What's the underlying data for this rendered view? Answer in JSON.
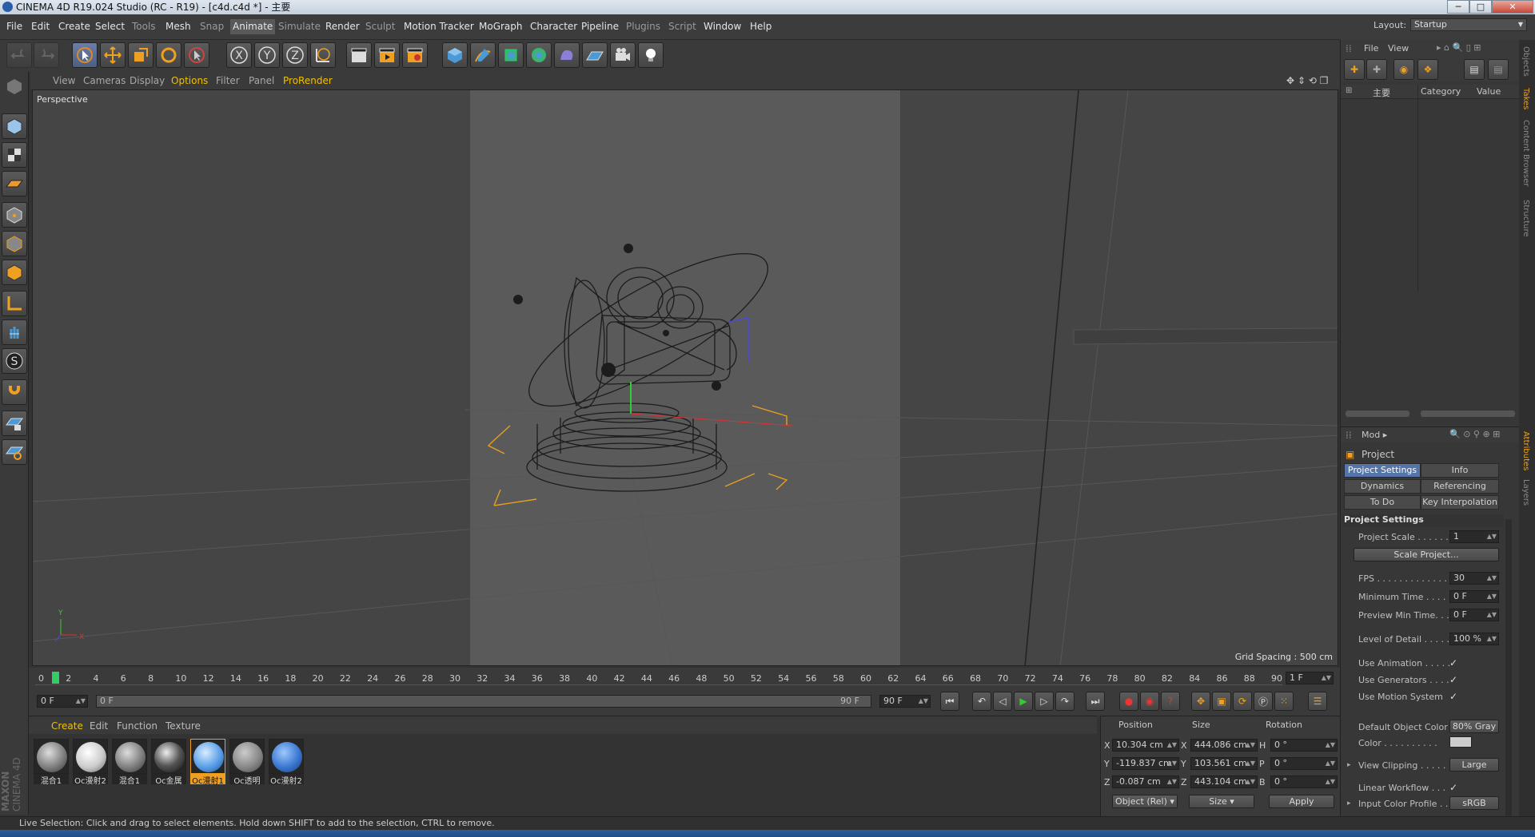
{
  "window": {
    "title": "CINEMA 4D R19.024 Studio (RC - R19) - [c4d.c4d *] - 主要",
    "min": "─",
    "max": "□",
    "close": "✕"
  },
  "menu": {
    "items": [
      "File",
      "Edit",
      "Create",
      "Select",
      "Tools",
      "Mesh",
      "Snap",
      "Animate",
      "Simulate",
      "Render",
      "Sculpt",
      "Motion Tracker",
      "MoGraph",
      "Character",
      "Pipeline",
      "Plugins",
      "Script",
      "Window",
      "Help"
    ],
    "layout_label": "Layout:",
    "layout_value": "Startup"
  },
  "viewport": {
    "menu": [
      "View",
      "Cameras",
      "Display",
      "Options",
      "Filter",
      "Panel",
      "ProRender"
    ],
    "name": "Perspective",
    "grid_spacing": "Grid Spacing : 500 cm",
    "axis_x": "X",
    "axis_y": "Y"
  },
  "timeline": {
    "ticks": [
      "0",
      "2",
      "4",
      "6",
      "8",
      "10",
      "12",
      "14",
      "16",
      "18",
      "20",
      "22",
      "24",
      "26",
      "28",
      "30",
      "32",
      "34",
      "36",
      "38",
      "40",
      "42",
      "44",
      "46",
      "48",
      "50",
      "52",
      "54",
      "56",
      "58",
      "60",
      "62",
      "64",
      "66",
      "68",
      "70",
      "72",
      "74",
      "76",
      "78",
      "80",
      "82",
      "84",
      "86",
      "88",
      "90"
    ],
    "current_frame": "1 F",
    "start_field": "0 F",
    "range_start": "0 F",
    "range_end": "90 F",
    "end_field": "90 F",
    "playhead_frame": 1,
    "max_frame": 90
  },
  "material_manager": {
    "menu": [
      "Create",
      "Edit",
      "Function",
      "Texture"
    ],
    "materials": [
      {
        "label": "混合1",
        "kind": "mix"
      },
      {
        "label": "Oc漫射2",
        "kind": "white"
      },
      {
        "label": "混合1",
        "kind": "mix"
      },
      {
        "label": "Oc金属",
        "kind": "metal"
      },
      {
        "label": "Oc漫射1",
        "kind": "blue",
        "selected": true
      },
      {
        "label": "Oc透明",
        "kind": "gray"
      },
      {
        "label": "Oc漫射2",
        "kind": "blue2"
      }
    ]
  },
  "coordinates": {
    "headers": [
      "Position",
      "Size",
      "Rotation"
    ],
    "rows": [
      {
        "axis": "X",
        "pos": "10.304 cm",
        "size_axis": "X",
        "size": "444.086 cm",
        "rot_axis": "H",
        "rot": "0 °"
      },
      {
        "axis": "Y",
        "pos": "-119.837 cm",
        "size_axis": "Y",
        "size": "103.561 cm",
        "rot_axis": "P",
        "rot": "0 °"
      },
      {
        "axis": "Z",
        "pos": "-0.087 cm",
        "size_axis": "Z",
        "size": "443.104 cm",
        "rot_axis": "B",
        "rot": "0 °"
      }
    ],
    "mode": "Object (Rel)",
    "size_mode": "Size",
    "apply": "Apply"
  },
  "object_manager": {
    "menu": [
      "File",
      "View"
    ],
    "root_item": "主要",
    "col_category": "Category",
    "col_value": "Value"
  },
  "attributes": {
    "mode_label": "Mod",
    "title": "Project",
    "tabs": [
      "Project Settings",
      "Info",
      "Dynamics",
      "Referencing",
      "To Do",
      "Key Interpolation"
    ],
    "section": "Project Settings",
    "fields": {
      "project_scale_label": "Project Scale . . . . . .",
      "project_scale": "1",
      "scale_project_btn": "Scale Project...",
      "fps_label": "FPS . . . . . . . . . . . . .",
      "fps": "30",
      "min_time_label": "Minimum Time . . . . .",
      "min_time": "0 F",
      "preview_min_label": "Preview Min Time. . .",
      "preview_min": "0 F",
      "lod_label": "Level of Detail . . . . .",
      "lod": "100 %",
      "use_anim_label": "Use Animation . . . . .",
      "use_gen_label": "Use Generators . . . .",
      "use_motion_label": "Use Motion System",
      "default_color_label": "Default Object Color",
      "default_color": "80% Gray",
      "color_label": "Color . . . . . . . . . .",
      "view_clip_label": "View Clipping . . . . .",
      "view_clip": "Large",
      "linear_wf_label": "Linear Workflow . . .",
      "input_profile_label": "Input Color Profile . .",
      "input_profile": "sRGB",
      "check": "✓"
    }
  },
  "side_tabs": [
    "Objects",
    "Takes",
    "Content Browser",
    "Structure",
    "Attributes",
    "Layers"
  ],
  "brand": {
    "maxon": "MAXON",
    "product": "CINEMA 4D"
  },
  "status": "Live Selection: Click and drag to select elements. Hold down SHIFT to add to the selection, CTRL to remove.",
  "colors": {
    "accent": "#f0c000",
    "selected_tab": "#5574a8",
    "playhead": "#33cc66"
  }
}
